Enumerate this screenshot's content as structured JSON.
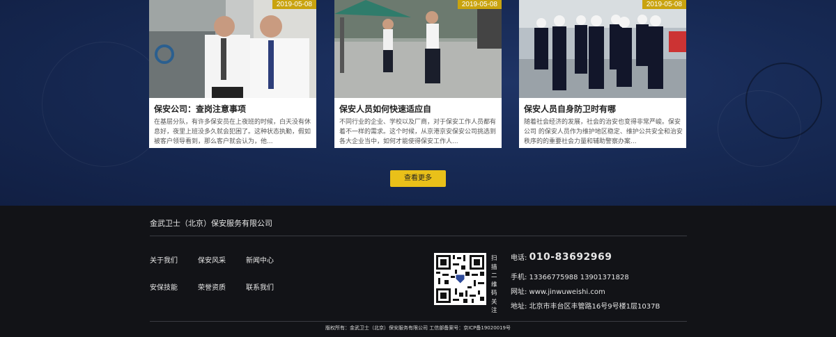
{
  "cards": [
    {
      "date": "2019-05-08",
      "title": "保安公司：查岗注意事项",
      "desc": "在基层分队，有许多保安员在上夜班的时候，白天没有休息好，夜里上班没多久就会犯困了。这种状态执勤，假如被客户领导看到，那么客户就会认为，他..."
    },
    {
      "date": "2019-05-08",
      "title": "保安人员如何快速适应自",
      "desc": "不同行业的企业、学校以及厂商，对于保安工作人员都有着不一样的需求。这个时候，从京港京安保安公司挑选到各大企业当中，如何才能使得保安工作人..."
    },
    {
      "date": "2019-05-08",
      "title": "保安人员自身防卫时有哪",
      "desc": "随着社会经济的发展，社会的治安也变得非常严峻。保安公司 的保安人员作为维护地区稳定、维护公共安全和治安秩序的的重要社会力量和辅助警察办案..."
    }
  ],
  "more_label": "查看更多",
  "footer": {
    "company": "金武卫士（北京）保安服务有限公司",
    "nav": [
      "关于我们",
      "保安风采",
      "新闻中心",
      "安保技能",
      "荣誉资质",
      "联系我们"
    ],
    "qr_label": "扫描二维码关注",
    "phone_label": "电话:",
    "phone": "010-83692969",
    "mobile": "手机: 13366775988   13901371828",
    "website": "网址: www.jinwuweishi.com",
    "address": "地址: 北京市丰台区丰管路16号9号楼1层1037B",
    "copyright": "版权所有：金武卫士（北京）保安服务有限公司 工信部备案号：京ICP备19020019号"
  },
  "colors": {
    "accent": "#e9c019",
    "date_badge": "#c9a30f",
    "footer_bg": "#121317"
  }
}
